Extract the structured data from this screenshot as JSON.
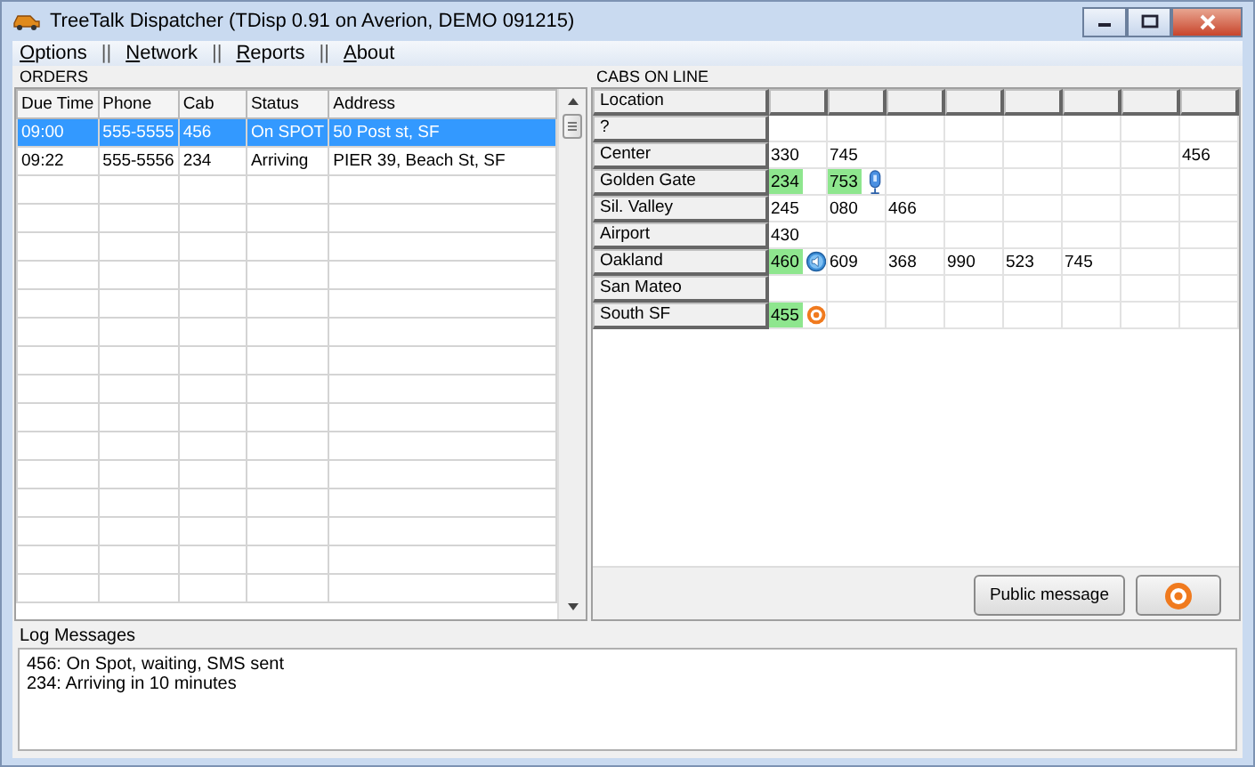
{
  "window": {
    "title": "TreeTalk Dispatcher (TDisp 0.91 on Averion, DEMO 091215)"
  },
  "menu": [
    {
      "kind": "item",
      "label": "Options"
    },
    {
      "kind": "separator",
      "label": "||"
    },
    {
      "kind": "item",
      "label": "Network"
    },
    {
      "kind": "separator",
      "label": "||"
    },
    {
      "kind": "item",
      "label": "Reports"
    },
    {
      "kind": "separator",
      "label": "||"
    },
    {
      "kind": "item",
      "label": "About"
    }
  ],
  "orders": {
    "title": "ORDERS",
    "columns": [
      "Due Time",
      "Phone",
      "Cab",
      "Status",
      "Address"
    ],
    "rows": [
      {
        "selected": true,
        "cells": [
          "09:00",
          "555-5555",
          "456",
          "On SPOT",
          "50 Post st, SF"
        ]
      },
      {
        "selected": false,
        "cells": [
          "09:22",
          "555-5556",
          "234",
          "Arriving",
          "PIER 39, Beach St, SF"
        ]
      }
    ]
  },
  "cabs": {
    "title": "CABS ON LINE",
    "location_header": "Location",
    "rows": [
      {
        "location": "?",
        "cells": [
          {},
          {},
          {},
          {},
          {},
          {},
          {},
          {}
        ]
      },
      {
        "location": "Center",
        "cells": [
          {
            "cab": "330",
            "active": false
          },
          {
            "cab": "745",
            "active": false
          },
          {},
          {},
          {},
          {},
          {},
          {
            "cab": "456",
            "active": false
          }
        ]
      },
      {
        "location": "Golden Gate",
        "cells": [
          {
            "cab": "234",
            "active": true
          },
          {
            "cab": "753",
            "active": true,
            "kind": "mic"
          },
          {},
          {},
          {},
          {},
          {},
          {}
        ]
      },
      {
        "location": "Sil. Valley",
        "cells": [
          {
            "cab": "245",
            "active": false
          },
          {
            "cab": "080",
            "active": false
          },
          {
            "cab": "466",
            "active": false
          },
          {},
          {},
          {},
          {},
          {}
        ]
      },
      {
        "location": "Airport",
        "cells": [
          {
            "cab": "430",
            "active": false
          },
          {},
          {},
          {},
          {},
          {},
          {},
          {}
        ]
      },
      {
        "location": "Oakland",
        "cells": [
          {
            "cab": "460",
            "active": true,
            "kind": "speaker"
          },
          {
            "cab": "609",
            "active": false
          },
          {
            "cab": "368",
            "active": false
          },
          {
            "cab": "990",
            "active": false
          },
          {
            "cab": "523",
            "active": false
          },
          {
            "cab": "745",
            "active": false
          },
          {},
          {}
        ]
      },
      {
        "location": "San Mateo",
        "cells": [
          {},
          {},
          {},
          {},
          {},
          {},
          {},
          {}
        ]
      },
      {
        "location": "South SF",
        "cells": [
          {
            "cab": "455",
            "active": true,
            "kind": "target"
          },
          {},
          {},
          {},
          {},
          {},
          {},
          {}
        ]
      }
    ],
    "buttons": [
      {
        "kind": "text",
        "label": "Public message"
      },
      {
        "kind": "target"
      }
    ]
  },
  "log": {
    "title": "Log Messages",
    "lines": [
      "456: On Spot, waiting, SMS sent",
      "234: Arriving in 10 minutes"
    ]
  }
}
